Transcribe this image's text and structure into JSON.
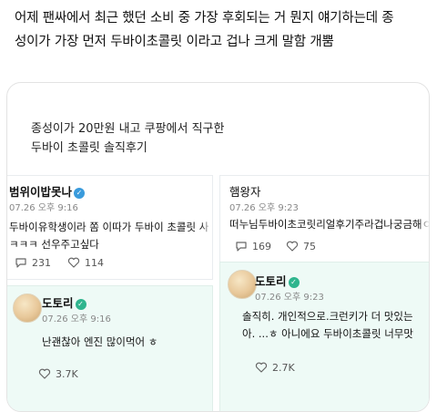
{
  "post": {
    "line1": "어제 팬싸에서  최근 했던 소비 중 가장 후회되는 거 뭔지 얘기하는데 종",
    "line2": "성이가 가장 먼저 두바이초콜릿 이라고 겁나 크게 말함 개뿜"
  },
  "card": {
    "title_line1": "종성이가 20만원 내고 쿠팡에서 직구한",
    "title_line2": "두바이 초콜릿 솔직후기"
  },
  "tweets": [
    {
      "name": "범위이밥못나",
      "time": "07.26 오후 9:16",
      "line1": "두바이유학생이라 쫌 이따가 두바이 초콜릿 사",
      "line2": "ㅋㅋㅋ 선우주고싶다",
      "comments": "231",
      "likes": "114",
      "verified": true
    },
    {
      "name": "햄왕자",
      "time": "07.26 오후 9:23",
      "line1": "떠누님두바이초코릿리얼후기주라겁나궁금해ㅇ",
      "comments": "169",
      "likes": "75",
      "verified": false
    },
    {
      "name": "도토리",
      "time": "07.26 오후 9:16",
      "line1": "난괜찮아 엔진 많이먹어 ㅎ",
      "likes": "3.7K",
      "verified": true
    },
    {
      "name": "도토리",
      "time": "07.26 오후 9:23",
      "line1": "솔직히. 개인적으로.크런키가 더 맛있는",
      "line2": "아. ...ㅎ 아니에요 두바이초콜릿 너무맛",
      "likes": "2.7K",
      "verified": true
    }
  ],
  "icons": {
    "comment": "comment-icon",
    "like": "heart-icon",
    "verified": "verified-badge-icon"
  },
  "colors": {
    "highlight_bg": "#eefaf6",
    "verified_blue": "#3a9bdc"
  }
}
